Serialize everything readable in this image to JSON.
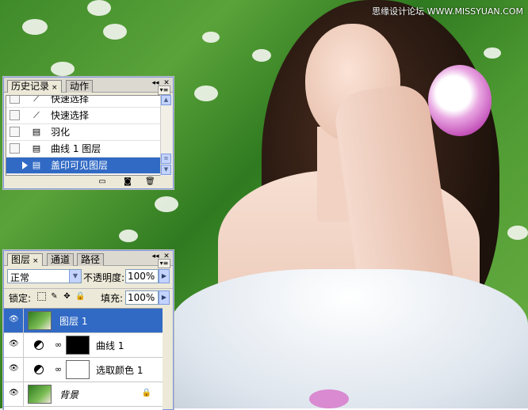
{
  "watermark": "思缘设计论坛 WWW.MISSYUAN.COM",
  "history_panel": {
    "tabs": [
      {
        "label": "历史记录",
        "active": true,
        "close": "×"
      },
      {
        "label": "动作",
        "active": false
      }
    ],
    "items": [
      {
        "label": "快速选择",
        "icon": "quick-select-icon",
        "selected": false
      },
      {
        "label": "快速选择",
        "icon": "quick-select-icon",
        "selected": false
      },
      {
        "label": "羽化",
        "icon": "history-state-icon",
        "selected": false
      },
      {
        "label": "曲线 1 图层",
        "icon": "history-state-icon",
        "selected": false
      },
      {
        "label": "盖印可见图层",
        "icon": "history-state-icon",
        "selected": true
      }
    ],
    "footer_icons": [
      "new-document-icon",
      "snapshot-icon",
      "trash-icon"
    ]
  },
  "layers_panel": {
    "tabs": [
      {
        "label": "图层",
        "active": true,
        "close": "×"
      },
      {
        "label": "通道",
        "active": false
      },
      {
        "label": "路径",
        "active": false
      }
    ],
    "blend_mode": "正常",
    "opacity_label": "不透明度:",
    "opacity_value": "100%",
    "lock_label": "锁定:",
    "fill_label": "填充:",
    "fill_value": "100%",
    "layers": [
      {
        "name": "图层 1",
        "thumb": "photo",
        "selected": true,
        "adjust": false,
        "locked": false,
        "italic": false
      },
      {
        "name": "曲线 1",
        "thumb": "black",
        "selected": false,
        "adjust": true,
        "locked": false,
        "italic": false
      },
      {
        "name": "选取颜色 1",
        "thumb": "white",
        "selected": false,
        "adjust": true,
        "locked": false,
        "italic": false
      },
      {
        "name": "背景",
        "thumb": "photo",
        "selected": false,
        "adjust": false,
        "locked": true,
        "italic": true
      }
    ]
  },
  "colors": {
    "selection": "#316ac5",
    "panel_bg": "#ece9d8"
  }
}
